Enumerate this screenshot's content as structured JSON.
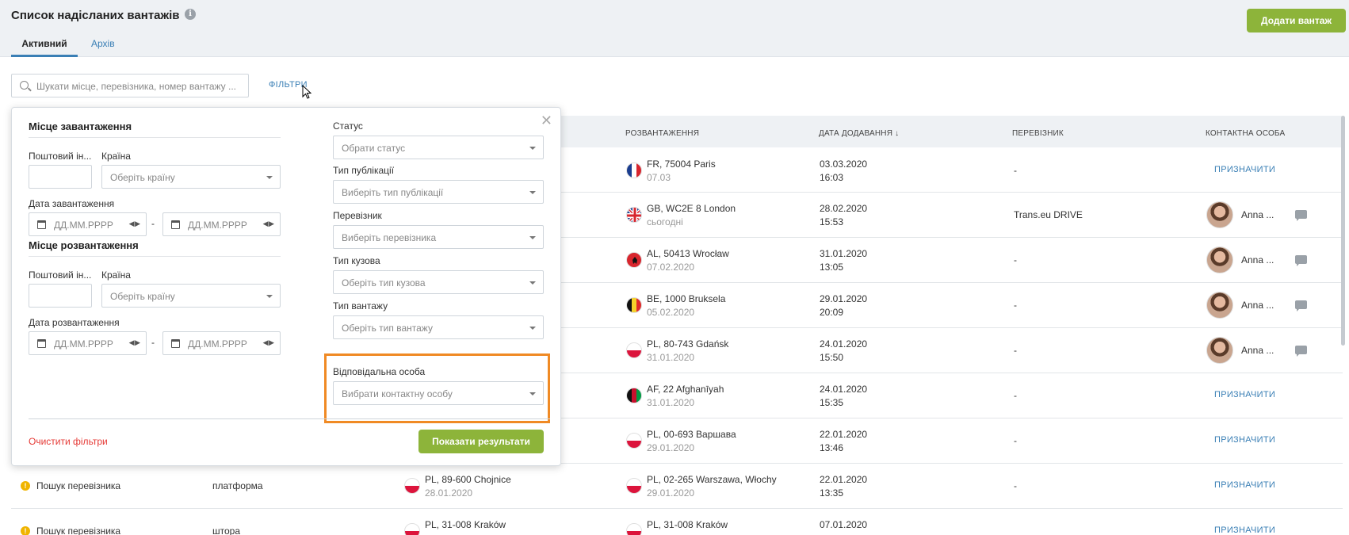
{
  "header": {
    "title": "Список надісланих вантажів",
    "info_icon": "info-icon",
    "tabs": [
      {
        "label": "Активний",
        "active": true
      },
      {
        "label": "Архів",
        "active": false
      }
    ],
    "add_button": "Додати вантаж"
  },
  "search": {
    "placeholder": "Шукати місце, перевізника, номер вантажу ...",
    "filters_link": "ФІЛЬТРИ"
  },
  "table": {
    "columns": [
      "РОЗВАНТАЖЕННЯ",
      "ДАТА ДОДАВАННЯ ↓",
      "ПЕРЕВІЗНИК",
      "КОНТАКТНА ОСОБА"
    ],
    "rows": [
      {
        "unload": "FR, 75004 Paris",
        "unload_date": "07.03",
        "added": "03.03.2020",
        "time": "16:03",
        "carrier": "-",
        "contact": "ПРИЗНАЧИТИ",
        "flag": "fr"
      },
      {
        "unload": "GB, WC2E 8 London",
        "unload_date": "сьогодні",
        "added": "28.02.2020",
        "time": "15:53",
        "carrier": "Trans.eu DRIVE",
        "contact": "Anna ...",
        "flag": "gb"
      },
      {
        "unload": "AL, 50413 Wrocław",
        "unload_date": "07.02.2020",
        "added": "31.01.2020",
        "time": "13:05",
        "carrier": "-",
        "contact": "Anna ...",
        "flag": "al"
      },
      {
        "unload": "BE, 1000 Bruksela",
        "unload_date": "05.02.2020",
        "added": "29.01.2020",
        "time": "20:09",
        "carrier": "-",
        "contact": "Anna ...",
        "flag": "be"
      },
      {
        "unload": "PL, 80-743 Gdańsk",
        "unload_date": "31.01.2020",
        "added": "24.01.2020",
        "time": "15:50",
        "carrier": "-",
        "contact": "Anna ...",
        "flag": "pl"
      },
      {
        "unload": "AF, 22 Afghanīyah",
        "unload_date": "31.01.2020",
        "added": "24.01.2020",
        "time": "15:35",
        "carrier": "-",
        "contact": "ПРИЗНАЧИТИ",
        "flag": "af"
      },
      {
        "unload": "PL, 00-693 Варшава",
        "unload_date": "29.01.2020",
        "added": "22.01.2020",
        "time": "13:46",
        "carrier": "-",
        "contact": "ПРИЗНАЧИТИ",
        "flag": "pl"
      },
      {
        "status": "Пошук перевізника",
        "body": "платформа",
        "load": "PL, 89-600 Chojnice",
        "load_date": "28.01.2020",
        "unload": "PL, 02-265 Warszawa, Włochy",
        "unload_date": "29.01.2020",
        "added": "22.01.2020",
        "time": "13:35",
        "carrier": "-",
        "contact": "ПРИЗНАЧИТИ",
        "flag": "pl"
      },
      {
        "status": "Пошук перевізника",
        "body": "штора",
        "load": "PL, 31-008 Kraków",
        "unload": "PL, 31-008 Kraków",
        "added": "07.01.2020",
        "carrier": "",
        "contact": "ПРИЗНАЧИТИ",
        "flag": "pl"
      }
    ]
  },
  "filter_panel": {
    "loading_title": "Місце завантаження",
    "postal_label": "Поштовий ін...",
    "country_label": "Країна",
    "country_placeholder": "Оберіть країну",
    "loading_date_label": "Дата завантаження",
    "date_placeholder": "ДД.ММ.РРРР",
    "unloading_title": "Місце розвантаження",
    "unloading_date_label": "Дата розвантаження",
    "status_label": "Статус",
    "status_placeholder": "Обрати статус",
    "pub_label": "Тип публікації",
    "pub_placeholder": "Виберіть тип публікації",
    "carrier_label": "Перевізник",
    "carrier_placeholder": "Виберіть перевізника",
    "body_label": "Тип кузова",
    "body_placeholder": "Оберіть тип кузова",
    "cargo_label": "Тип вантажу",
    "cargo_placeholder": "Оберіть тип вантажу",
    "resp_label": "Відповідальна особа",
    "resp_placeholder": "Вибрати контактну особу",
    "clear": "Очистити фільтри",
    "show": "Показати результати",
    "dash": "-",
    "close": "✕"
  },
  "colors": {
    "accent": "#3a7fb5",
    "primary_button": "#8db43a",
    "highlight": "#f08a24",
    "danger": "#e53935"
  }
}
